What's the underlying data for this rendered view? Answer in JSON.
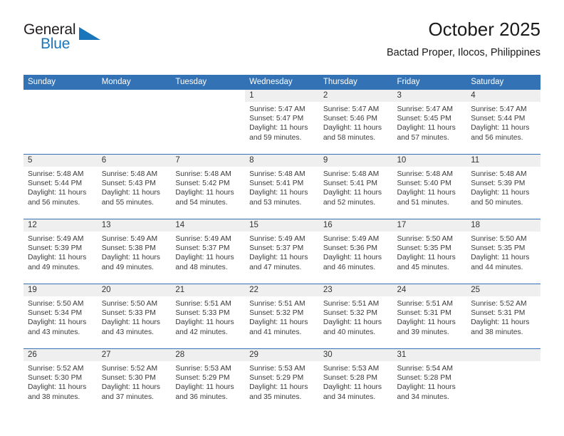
{
  "logo": {
    "word_one": "General",
    "word_two": "Blue",
    "accent_color": "#1b75bb",
    "triangle_icon": "triangle-right-icon"
  },
  "header": {
    "title": "October 2025",
    "subtitle": "Bactad Proper, Ilocos, Philippines"
  },
  "calendar": {
    "header_color": "#3272b5",
    "daynum_band_color": "#efefef",
    "weekday_headers": [
      "Sunday",
      "Monday",
      "Tuesday",
      "Wednesday",
      "Thursday",
      "Friday",
      "Saturday"
    ],
    "weeks": [
      [
        {
          "day": "",
          "lines": []
        },
        {
          "day": "",
          "lines": []
        },
        {
          "day": "",
          "lines": []
        },
        {
          "day": "1",
          "lines": [
            "Sunrise: 5:47 AM",
            "Sunset: 5:47 PM",
            "Daylight: 11 hours",
            "and 59 minutes."
          ]
        },
        {
          "day": "2",
          "lines": [
            "Sunrise: 5:47 AM",
            "Sunset: 5:46 PM",
            "Daylight: 11 hours",
            "and 58 minutes."
          ]
        },
        {
          "day": "3",
          "lines": [
            "Sunrise: 5:47 AM",
            "Sunset: 5:45 PM",
            "Daylight: 11 hours",
            "and 57 minutes."
          ]
        },
        {
          "day": "4",
          "lines": [
            "Sunrise: 5:47 AM",
            "Sunset: 5:44 PM",
            "Daylight: 11 hours",
            "and 56 minutes."
          ]
        }
      ],
      [
        {
          "day": "5",
          "lines": [
            "Sunrise: 5:48 AM",
            "Sunset: 5:44 PM",
            "Daylight: 11 hours",
            "and 56 minutes."
          ]
        },
        {
          "day": "6",
          "lines": [
            "Sunrise: 5:48 AM",
            "Sunset: 5:43 PM",
            "Daylight: 11 hours",
            "and 55 minutes."
          ]
        },
        {
          "day": "7",
          "lines": [
            "Sunrise: 5:48 AM",
            "Sunset: 5:42 PM",
            "Daylight: 11 hours",
            "and 54 minutes."
          ]
        },
        {
          "day": "8",
          "lines": [
            "Sunrise: 5:48 AM",
            "Sunset: 5:41 PM",
            "Daylight: 11 hours",
            "and 53 minutes."
          ]
        },
        {
          "day": "9",
          "lines": [
            "Sunrise: 5:48 AM",
            "Sunset: 5:41 PM",
            "Daylight: 11 hours",
            "and 52 minutes."
          ]
        },
        {
          "day": "10",
          "lines": [
            "Sunrise: 5:48 AM",
            "Sunset: 5:40 PM",
            "Daylight: 11 hours",
            "and 51 minutes."
          ]
        },
        {
          "day": "11",
          "lines": [
            "Sunrise: 5:48 AM",
            "Sunset: 5:39 PM",
            "Daylight: 11 hours",
            "and 50 minutes."
          ]
        }
      ],
      [
        {
          "day": "12",
          "lines": [
            "Sunrise: 5:49 AM",
            "Sunset: 5:39 PM",
            "Daylight: 11 hours",
            "and 49 minutes."
          ]
        },
        {
          "day": "13",
          "lines": [
            "Sunrise: 5:49 AM",
            "Sunset: 5:38 PM",
            "Daylight: 11 hours",
            "and 49 minutes."
          ]
        },
        {
          "day": "14",
          "lines": [
            "Sunrise: 5:49 AM",
            "Sunset: 5:37 PM",
            "Daylight: 11 hours",
            "and 48 minutes."
          ]
        },
        {
          "day": "15",
          "lines": [
            "Sunrise: 5:49 AM",
            "Sunset: 5:37 PM",
            "Daylight: 11 hours",
            "and 47 minutes."
          ]
        },
        {
          "day": "16",
          "lines": [
            "Sunrise: 5:49 AM",
            "Sunset: 5:36 PM",
            "Daylight: 11 hours",
            "and 46 minutes."
          ]
        },
        {
          "day": "17",
          "lines": [
            "Sunrise: 5:50 AM",
            "Sunset: 5:35 PM",
            "Daylight: 11 hours",
            "and 45 minutes."
          ]
        },
        {
          "day": "18",
          "lines": [
            "Sunrise: 5:50 AM",
            "Sunset: 5:35 PM",
            "Daylight: 11 hours",
            "and 44 minutes."
          ]
        }
      ],
      [
        {
          "day": "19",
          "lines": [
            "Sunrise: 5:50 AM",
            "Sunset: 5:34 PM",
            "Daylight: 11 hours",
            "and 43 minutes."
          ]
        },
        {
          "day": "20",
          "lines": [
            "Sunrise: 5:50 AM",
            "Sunset: 5:33 PM",
            "Daylight: 11 hours",
            "and 43 minutes."
          ]
        },
        {
          "day": "21",
          "lines": [
            "Sunrise: 5:51 AM",
            "Sunset: 5:33 PM",
            "Daylight: 11 hours",
            "and 42 minutes."
          ]
        },
        {
          "day": "22",
          "lines": [
            "Sunrise: 5:51 AM",
            "Sunset: 5:32 PM",
            "Daylight: 11 hours",
            "and 41 minutes."
          ]
        },
        {
          "day": "23",
          "lines": [
            "Sunrise: 5:51 AM",
            "Sunset: 5:32 PM",
            "Daylight: 11 hours",
            "and 40 minutes."
          ]
        },
        {
          "day": "24",
          "lines": [
            "Sunrise: 5:51 AM",
            "Sunset: 5:31 PM",
            "Daylight: 11 hours",
            "and 39 minutes."
          ]
        },
        {
          "day": "25",
          "lines": [
            "Sunrise: 5:52 AM",
            "Sunset: 5:31 PM",
            "Daylight: 11 hours",
            "and 38 minutes."
          ]
        }
      ],
      [
        {
          "day": "26",
          "lines": [
            "Sunrise: 5:52 AM",
            "Sunset: 5:30 PM",
            "Daylight: 11 hours",
            "and 38 minutes."
          ]
        },
        {
          "day": "27",
          "lines": [
            "Sunrise: 5:52 AM",
            "Sunset: 5:30 PM",
            "Daylight: 11 hours",
            "and 37 minutes."
          ]
        },
        {
          "day": "28",
          "lines": [
            "Sunrise: 5:53 AM",
            "Sunset: 5:29 PM",
            "Daylight: 11 hours",
            "and 36 minutes."
          ]
        },
        {
          "day": "29",
          "lines": [
            "Sunrise: 5:53 AM",
            "Sunset: 5:29 PM",
            "Daylight: 11 hours",
            "and 35 minutes."
          ]
        },
        {
          "day": "30",
          "lines": [
            "Sunrise: 5:53 AM",
            "Sunset: 5:28 PM",
            "Daylight: 11 hours",
            "and 34 minutes."
          ]
        },
        {
          "day": "31",
          "lines": [
            "Sunrise: 5:54 AM",
            "Sunset: 5:28 PM",
            "Daylight: 11 hours",
            "and 34 minutes."
          ]
        },
        {
          "day": "",
          "lines": []
        }
      ]
    ]
  }
}
